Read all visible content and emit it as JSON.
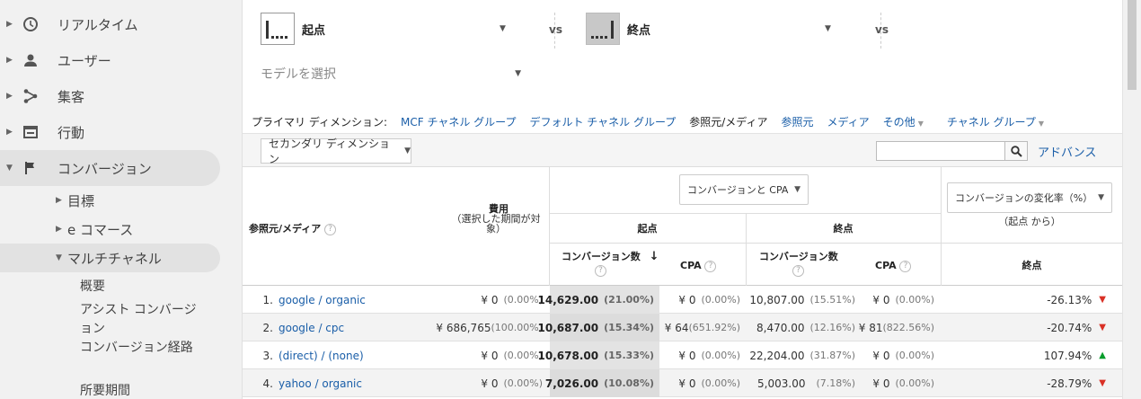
{
  "sidebar": {
    "items": [
      {
        "label": "リアルタイム"
      },
      {
        "label": "ユーザー"
      },
      {
        "label": "集客"
      },
      {
        "label": "行動"
      },
      {
        "label": "コンバージョン"
      }
    ],
    "sub_items": [
      {
        "label": "目標"
      },
      {
        "label": "e コマース"
      },
      {
        "label": "マルチチャネル"
      }
    ],
    "leaves": [
      {
        "label": "概要"
      },
      {
        "label": "アシスト コンバージョン"
      },
      {
        "label": "コンバージョン経路"
      },
      {
        "label": "所要期間"
      }
    ]
  },
  "models": {
    "left_label": "起点",
    "right_label": "終点",
    "vs": "vs",
    "select_placeholder": "モデルを選択"
  },
  "primary_dimension": {
    "label": "プライマリ ディメンション:",
    "options": [
      "MCF チャネル グループ",
      "デフォルト チャネル グループ"
    ],
    "current": "参照元/メディア",
    "more": [
      "参照元",
      "メディア"
    ],
    "other": "その他",
    "channel_group": "チャネル グループ"
  },
  "toolbar": {
    "secondary_dimension": "セカンダリ ディメンション",
    "advanced": "アドバンス"
  },
  "table": {
    "col_source": "参照元/メディア",
    "col_cost": "費用",
    "col_cost_note": "（選択した期間が対象）",
    "metric_dropdown": "コンバージョンと CPA",
    "change_dropdown": "コンバージョンの変化率（%）",
    "change_note": "（起点 から）",
    "group_start": "起点",
    "group_end": "終点",
    "conversions": "コンバージョン数",
    "cpa": "CPA",
    "end_label": "終点",
    "rows": [
      {
        "num": "1.",
        "source": "google / organic",
        "cost": "¥ 0",
        "cost_pct": "(0.00%)",
        "s_conv": "14,629.00",
        "s_conv_pct": "(21.00%)",
        "s_cpa": "¥ 0",
        "s_cpa_pct": "(0.00%)",
        "e_conv": "10,807.00",
        "e_conv_pct": "(15.51%)",
        "e_cpa": "¥ 0",
        "e_cpa_pct": "(0.00%)",
        "change": "-26.13%",
        "trend": "down"
      },
      {
        "num": "2.",
        "source": "google / cpc",
        "cost": "¥ 686,765",
        "cost_pct": "(100.00%)",
        "s_conv": "10,687.00",
        "s_conv_pct": "(15.34%)",
        "s_cpa": "¥ 64",
        "s_cpa_pct": "(651.92%)",
        "e_conv": "8,470.00",
        "e_conv_pct": "(12.16%)",
        "e_cpa": "¥ 81",
        "e_cpa_pct": "(822.56%)",
        "change": "-20.74%",
        "trend": "down"
      },
      {
        "num": "3.",
        "source": "(direct) / (none)",
        "cost": "¥ 0",
        "cost_pct": "(0.00%)",
        "s_conv": "10,678.00",
        "s_conv_pct": "(15.33%)",
        "s_cpa": "¥ 0",
        "s_cpa_pct": "(0.00%)",
        "e_conv": "22,204.00",
        "e_conv_pct": "(31.87%)",
        "e_cpa": "¥ 0",
        "e_cpa_pct": "(0.00%)",
        "change": "107.94%",
        "trend": "up"
      },
      {
        "num": "4.",
        "source": "yahoo / organic",
        "cost": "¥ 0",
        "cost_pct": "(0.00%)",
        "s_conv": "7,026.00",
        "s_conv_pct": "(10.08%)",
        "s_cpa": "¥ 0",
        "s_cpa_pct": "(0.00%)",
        "e_conv": "5,003.00",
        "e_conv_pct": "(7.18%)",
        "e_cpa": "¥ 0",
        "e_cpa_pct": "(0.00%)",
        "change": "-28.79%",
        "trend": "down"
      }
    ]
  },
  "colors": {
    "link": "#1a5ea8",
    "up": "#0a9d2c",
    "down": "#d93025"
  }
}
